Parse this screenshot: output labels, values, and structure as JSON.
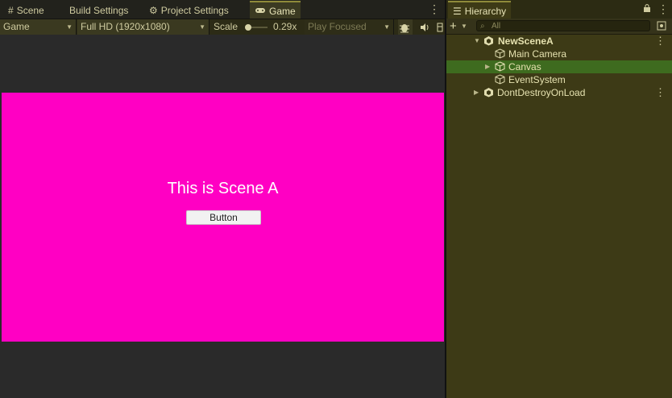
{
  "game_panel": {
    "tabs": [
      {
        "label": "Scene",
        "icon": "hash-icon"
      },
      {
        "label": "Build Settings",
        "icon": ""
      },
      {
        "label": "Project Settings",
        "icon": "gear-icon"
      },
      {
        "label": "Game",
        "icon": "gamepad-icon",
        "active": true
      }
    ],
    "toolbar": {
      "display_mode": "Game",
      "resolution": "Full HD (1920x1080)",
      "scale_label": "Scale",
      "scale_value": "0.29x",
      "play_mode": "Play Focused"
    },
    "game_view": {
      "background_color": "#ff00c3",
      "title_text": "This is Scene A",
      "button_label": "Button"
    }
  },
  "hierarchy": {
    "tab_label": "Hierarchy",
    "search_placeholder": "All",
    "items": [
      {
        "label": "NewSceneA",
        "kind": "scene"
      },
      {
        "label": "Main Camera",
        "kind": "gameobject"
      },
      {
        "label": "Canvas",
        "kind": "gameobject",
        "selected": true
      },
      {
        "label": "EventSystem",
        "kind": "gameobject"
      },
      {
        "label": "DontDestroyOnLoad",
        "kind": "scene"
      }
    ]
  },
  "colors": {
    "accent_olive": "#3d3a16",
    "selection_green": "#3e6b1f",
    "game_magenta": "#ff00c3"
  }
}
